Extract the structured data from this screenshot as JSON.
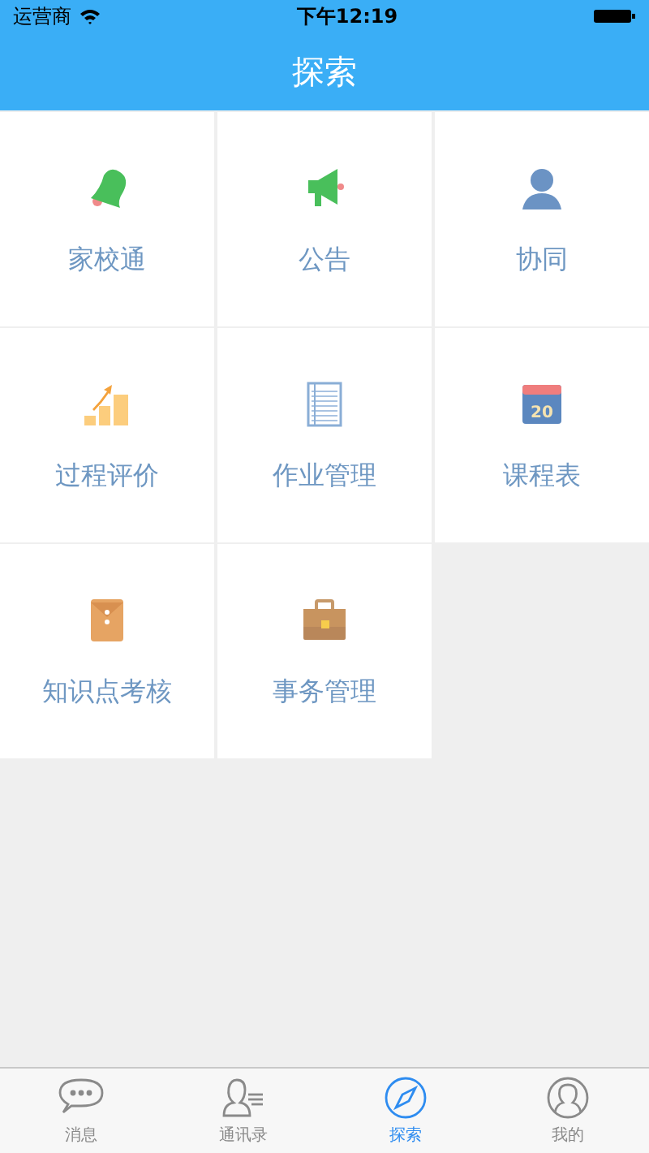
{
  "status_bar": {
    "carrier": "运营商",
    "time": "下午12:19"
  },
  "header": {
    "title": "探索"
  },
  "grid": [
    {
      "label": "家校通",
      "kind": "bell"
    },
    {
      "label": "公告",
      "kind": "megaphone"
    },
    {
      "label": "协同",
      "kind": "person"
    },
    {
      "label": "过程评价",
      "kind": "growth"
    },
    {
      "label": "作业管理",
      "kind": "notebook"
    },
    {
      "label": "课程表",
      "kind": "calendar",
      "icon_text": "20"
    },
    {
      "label": "知识点考核",
      "kind": "envelope"
    },
    {
      "label": "事务管理",
      "kind": "briefcase"
    }
  ],
  "tab_bar": [
    {
      "label": "消息",
      "kind": "chat",
      "selected": false
    },
    {
      "label": "通讯录",
      "kind": "contacts",
      "selected": false
    },
    {
      "label": "探索",
      "kind": "compass",
      "selected": true
    },
    {
      "label": "我的",
      "kind": "user",
      "selected": false
    }
  ]
}
